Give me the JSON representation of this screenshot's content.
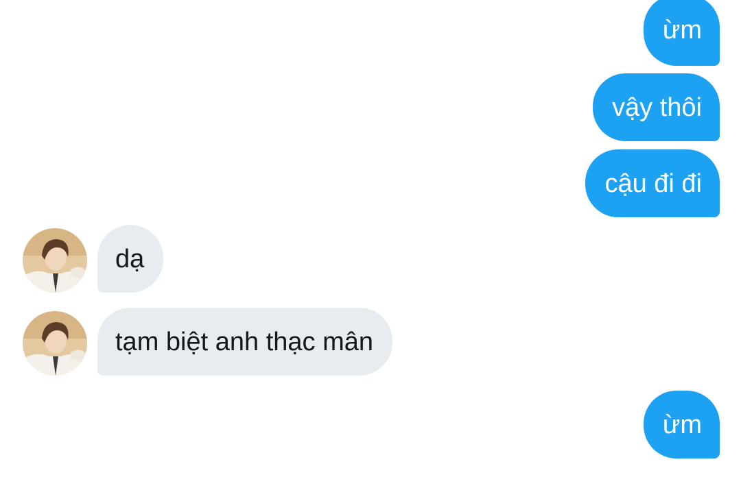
{
  "messages": [
    {
      "side": "out",
      "text": "ừm"
    },
    {
      "side": "out",
      "text": "vậy thôi"
    },
    {
      "side": "out",
      "text": "cậu đi đi"
    },
    {
      "side": "in",
      "text": "dạ"
    },
    {
      "side": "in",
      "text": "tạm biệt anh thạc mân"
    },
    {
      "side": "out",
      "text": "ừm"
    }
  ],
  "colors": {
    "outgoing_bubble": "#1da1f2",
    "incoming_bubble": "#e7ecf0",
    "background": "#ffffff"
  },
  "avatar_icon": "user-photo-icon"
}
